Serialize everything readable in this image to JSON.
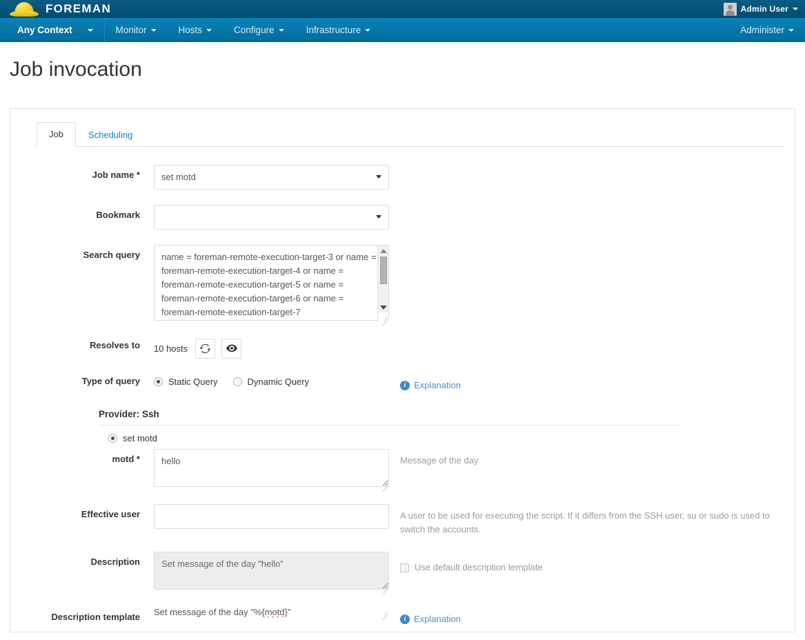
{
  "masthead": {
    "brand": "FOREMAN",
    "logo_icon": "hard-hat-icon",
    "user": "Admin User",
    "avatar_icon": "user-avatar-icon",
    "caret_icon": "caret-down-icon"
  },
  "navbar": {
    "context": "Any Context",
    "items": [
      {
        "label": "Monitor"
      },
      {
        "label": "Hosts"
      },
      {
        "label": "Configure"
      },
      {
        "label": "Infrastructure"
      }
    ],
    "right": {
      "label": "Administer"
    }
  },
  "page": {
    "title": "Job invocation"
  },
  "tabs": [
    {
      "label": "Job",
      "active": true
    },
    {
      "label": "Scheduling",
      "active": false
    }
  ],
  "form": {
    "job_name": {
      "label": "Job name *",
      "value": "set motd"
    },
    "bookmark": {
      "label": "Bookmark",
      "value": ""
    },
    "search_query": {
      "label": "Search query",
      "value": "name = foreman-remote-execution-target-3 or name = foreman-remote-execution-target-4 or name = foreman-remote-execution-target-5 or name = foreman-remote-execution-target-6 or name = foreman-remote-execution-target-7"
    },
    "resolves_to": {
      "label": "Resolves to",
      "count_text": "10 hosts",
      "refresh_icon": "refresh-icon",
      "preview_icon": "eye-icon"
    },
    "type_of_query": {
      "label": "Type of query",
      "options": [
        {
          "label": "Static Query",
          "selected": true
        },
        {
          "label": "Dynamic Query",
          "selected": false
        }
      ],
      "explanation": "Explanation",
      "info_icon": "info-circle-icon"
    },
    "provider": {
      "heading": "Provider: Ssh",
      "template_option": {
        "label": "set motd",
        "selected": true
      }
    },
    "motd": {
      "label": "motd *",
      "value": "hello",
      "help": "Message of the day"
    },
    "effective_user": {
      "label": "Effective user",
      "value": "",
      "help": "A user to be used for executing the script. If it differs from the SSH user, su or sudo is used to switch the accounts."
    },
    "description": {
      "label": "Description",
      "value": "Set message of the day \"hello\"",
      "checkbox_label": "Use default description template",
      "checkbox_checked": false,
      "disabled": true
    },
    "description_template": {
      "label": "Description template",
      "value_prefix": "Set message of the day \"%{",
      "value_spelled": "motd",
      "value_suffix": "}\"",
      "explanation": "Explanation",
      "info_icon": "info-circle-icon"
    }
  },
  "colors": {
    "masthead_bg": "#02557f",
    "navbar_bg": "#0276ab",
    "link": "#4d90c4",
    "logo_yellow": "#f2cf1c"
  }
}
